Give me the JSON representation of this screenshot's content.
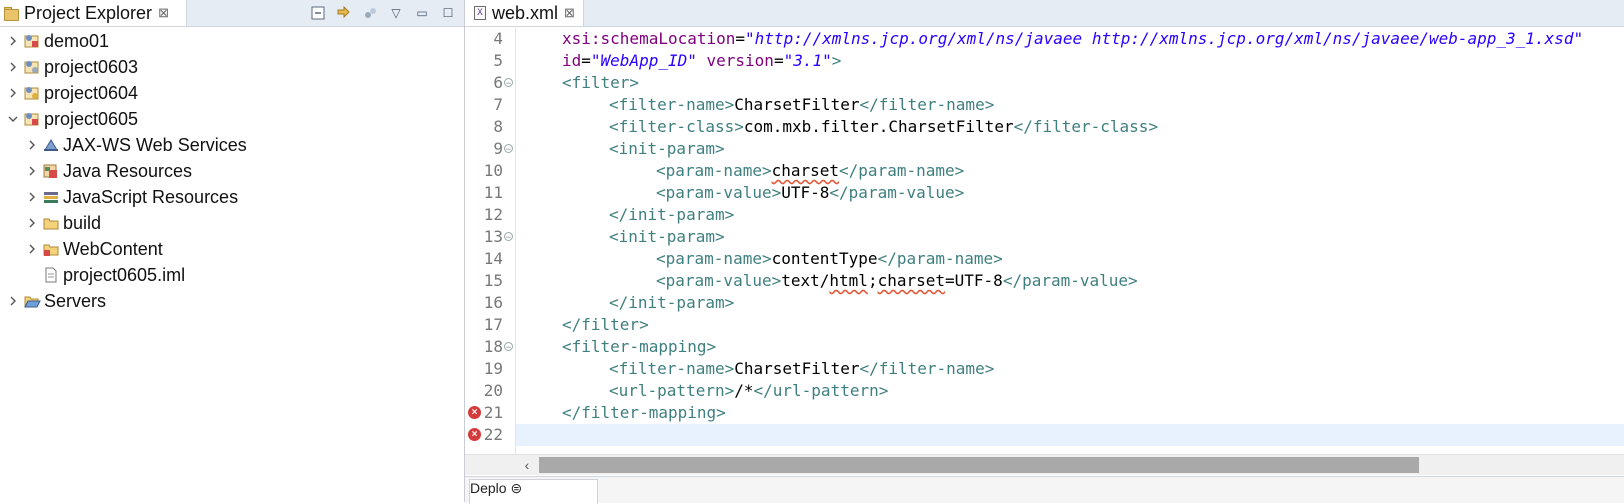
{
  "project_explorer": {
    "tab_title": "Project Explorer",
    "close_glyph": "⊠",
    "toolbar": {
      "collapse_all": "collapse-all-icon",
      "link_editor": "link-with-editor-icon",
      "focus": "focus-icon",
      "view_menu": "▽",
      "minimize": "▭",
      "maximize": "☐"
    },
    "tree": [
      {
        "label": "demo01",
        "expanded": false
      },
      {
        "label": "project0603",
        "expanded": false
      },
      {
        "label": "project0604",
        "expanded": false
      },
      {
        "label": "project0605",
        "expanded": true
      },
      {
        "label": "JAX-WS Web Services",
        "expanded": false
      },
      {
        "label": "Java Resources",
        "expanded": false
      },
      {
        "label": "JavaScript Resources",
        "expanded": false
      },
      {
        "label": "build",
        "expanded": false
      },
      {
        "label": "WebContent",
        "expanded": false
      },
      {
        "label": "project0605.iml",
        "expanded": null
      },
      {
        "label": "Servers",
        "expanded": false
      }
    ]
  },
  "editor": {
    "tab_title": "web.xml",
    "tab_icon_glyph": "X",
    "close_glyph": "⊠",
    "lines": [
      {
        "n": "4"
      },
      {
        "n": "5"
      },
      {
        "n": "6"
      },
      {
        "n": "7"
      },
      {
        "n": "8"
      },
      {
        "n": "9"
      },
      {
        "n": "10"
      },
      {
        "n": "11"
      },
      {
        "n": "12"
      },
      {
        "n": "13"
      },
      {
        "n": "14"
      },
      {
        "n": "15"
      },
      {
        "n": "16"
      },
      {
        "n": "17"
      },
      {
        "n": "18"
      },
      {
        "n": "19"
      },
      {
        "n": "20"
      },
      {
        "n": "21"
      },
      {
        "n": "22"
      }
    ],
    "code": {
      "l4_attr": "xsi:schemaLocation",
      "l4_eq": "=",
      "l4_val": "\"http://xmlns.jcp.org/xml/ns/javaee http://xmlns.jcp.org/xml/ns/javaee/web-app_3_1.xsd\"",
      "l5_attr1": "id",
      "l5_eq": "=",
      "l5_val1": "\"WebApp_ID\"",
      "l5_attr2": " version",
      "l5_val2": "\"3.1\"",
      "l5_end": ">",
      "l6": "<filter>",
      "l7_open": "<filter-name>",
      "l7_text": "CharsetFilter",
      "l7_close": "</filter-name>",
      "l8_open": "<filter-class>",
      "l8_text": "com.mxb.filter.CharsetFilter",
      "l8_close": "</filter-class>",
      "l9": "<init-param>",
      "l10_open": "<param-name>",
      "l10_text": "charset",
      "l10_close": "</param-name>",
      "l11_open": "<param-value>",
      "l11_text": "UTF-8",
      "l11_close": "</param-value>",
      "l12": "</init-param>",
      "l13": "<init-param>",
      "l14_open": "<param-name>",
      "l14_text": "contentType",
      "l14_close": "</param-name>",
      "l15_open": "<param-value>",
      "l15_text1": "text/",
      "l15_text2": "html",
      "l15_text3": ";",
      "l15_text4": "charset",
      "l15_text5": "=UTF-8",
      "l15_close": "</param-value>",
      "l16": "</init-param>",
      "l17": "</filter>",
      "l18": "<filter-mapping>",
      "l19_open": "<filter-name>",
      "l19_text": "CharsetFilter",
      "l19_close": "</filter-name>",
      "l20_open": "<url-pattern>",
      "l20_text": "/*",
      "l20_close": "</url-pattern>",
      "l21": "</filter-mapping>",
      "l22": ""
    },
    "error_markers": [
      "21",
      "22"
    ],
    "fold_lines": [
      "6",
      "9",
      "13",
      "18"
    ],
    "bottom_tab_text": "Deplo ⊜"
  },
  "colors": {
    "xml_tag": "#3f7f7f",
    "xml_attr": "#7f007f",
    "xml_value": "#2a00ff",
    "current_line": "#e8f2fe",
    "error": "#d63b3b"
  }
}
